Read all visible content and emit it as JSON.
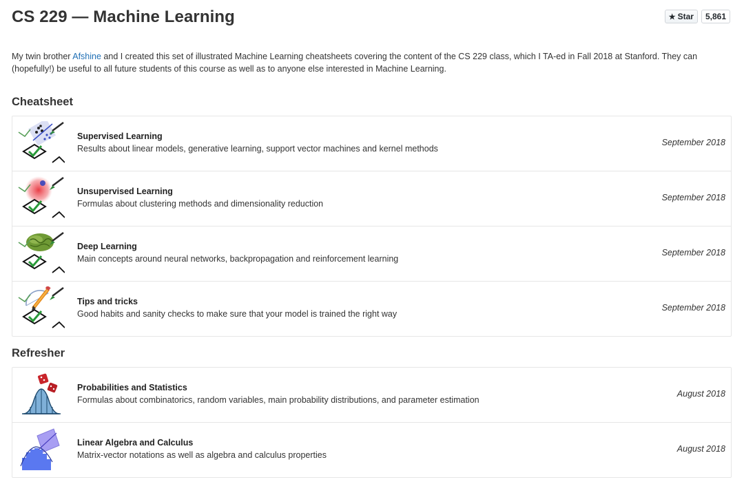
{
  "header": {
    "title": "CS 229 — Machine Learning",
    "star_label": "Star",
    "star_count": "5,861"
  },
  "intro": {
    "before_link": "My twin brother ",
    "link_text": "Afshine",
    "after_link": " and I created this set of illustrated Machine Learning cheatsheets covering the content of the CS 229 class, which I TA-ed in Fall 2018 at Stanford. They can (hopefully!) be useful to all future students of this course as well as to anyone else interested in Machine Learning."
  },
  "cheatsheet": {
    "heading": "Cheatsheet",
    "items": [
      {
        "title": "Supervised Learning",
        "description": "Results about linear models, generative learning, support vector machines and kernel methods",
        "date": "September 2018",
        "icon": "supervised-learning-icon"
      },
      {
        "title": "Unsupervised Learning",
        "description": "Formulas about clustering methods and dimensionality reduction",
        "date": "September 2018",
        "icon": "unsupervised-learning-icon"
      },
      {
        "title": "Deep Learning",
        "description": "Main concepts around neural networks, backpropagation and reinforcement learning",
        "date": "September 2018",
        "icon": "deep-learning-icon"
      },
      {
        "title": "Tips and tricks",
        "description": "Good habits and sanity checks to make sure that your model is trained the right way",
        "date": "September 2018",
        "icon": "tips-and-tricks-icon"
      }
    ]
  },
  "refresher": {
    "heading": "Refresher",
    "items": [
      {
        "title": "Probabilities and Statistics",
        "description": "Formulas about combinatorics, random variables, main probability distributions, and parameter estimation",
        "date": "August 2018",
        "icon": "probability-dice-icon"
      },
      {
        "title": "Linear Algebra and Calculus",
        "description": "Matrix-vector notations as well as algebra and calculus properties",
        "date": "August 2018",
        "icon": "linear-algebra-icon"
      }
    ]
  },
  "colors": {
    "link": "#1f6fb5",
    "border": "#e6e6e6",
    "text": "#333333"
  }
}
